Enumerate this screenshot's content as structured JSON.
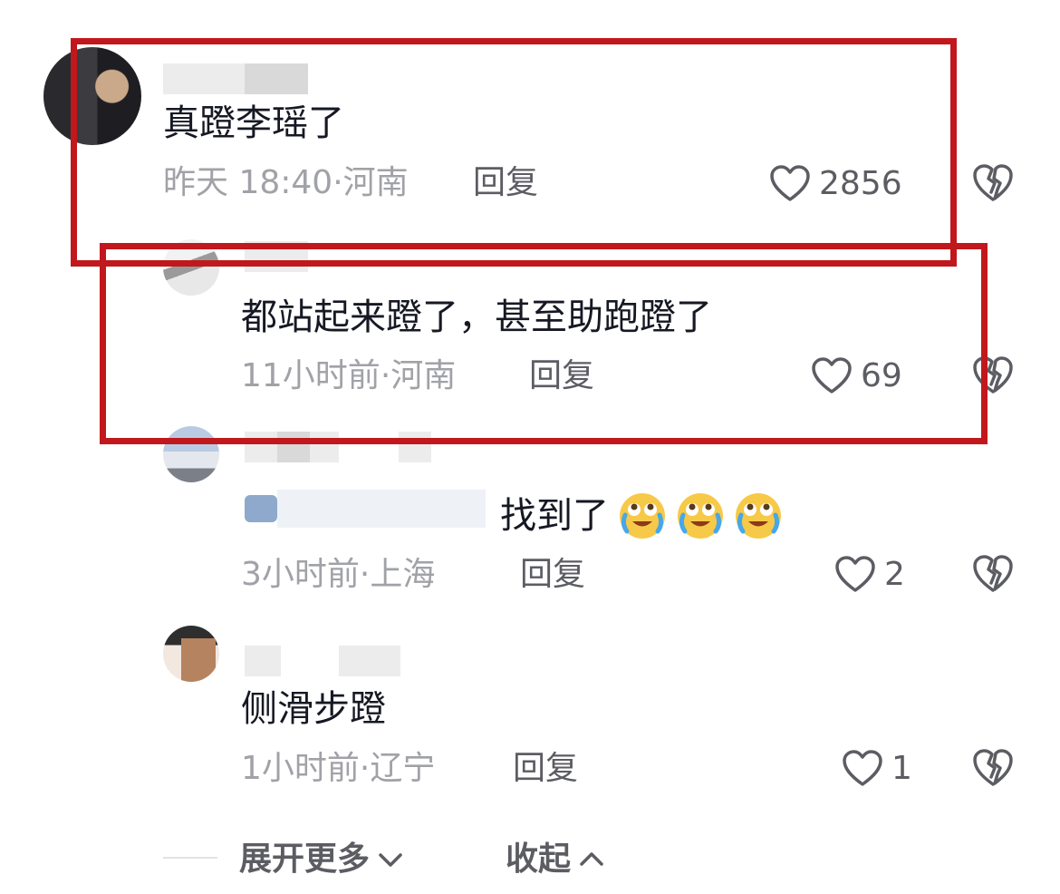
{
  "comments": [
    {
      "username": "",
      "content": "真蹬李瑶了",
      "time": "昨天 18:40",
      "location": "河南",
      "reply_label": "回复",
      "likes": "2856"
    },
    {
      "username": "",
      "content": "都站起来蹬了，甚至助跑蹬了",
      "time": "11小时前",
      "location": "河南",
      "reply_label": "回复",
      "likes": "69"
    },
    {
      "username": "",
      "content": "找到了",
      "time": "3小时前",
      "location": "上海",
      "reply_label": "回复",
      "likes": "2"
    },
    {
      "username": "",
      "content": "侧滑步蹬",
      "time": "1小时前",
      "location": "辽宁",
      "reply_label": "回复",
      "likes": "1"
    }
  ],
  "meta_separator": "·",
  "footer": {
    "expand_label": "展开更多",
    "collapse_label": "收起"
  },
  "colors": {
    "highlight": "#c0181c",
    "meta": "#a1a2a7",
    "text": "#161823"
  },
  "icons": {
    "like": "heart-outline-icon",
    "dislike": "broken-heart-icon",
    "expand": "chevron-down-icon",
    "collapse": "chevron-up-icon",
    "emoji": "crying-laughing-emoji-icon"
  }
}
